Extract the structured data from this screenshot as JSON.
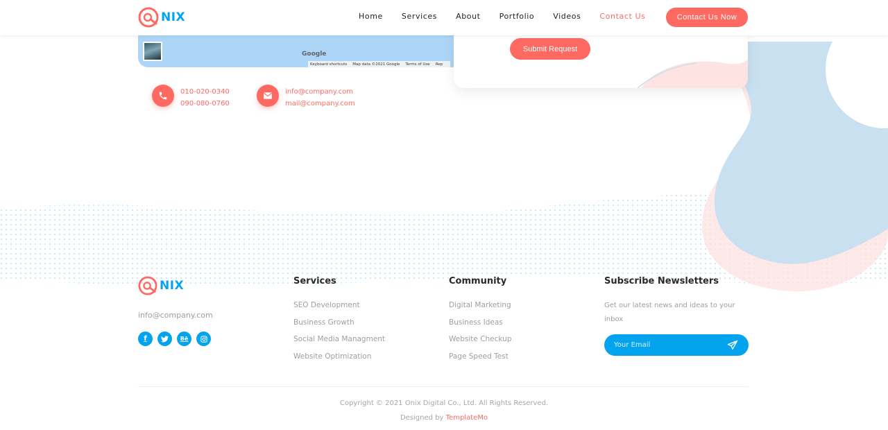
{
  "brand": {
    "name": "NIX"
  },
  "colors": {
    "accent": "#fe6a61",
    "blue": "#03a4ed",
    "heading": "#2a2a2a",
    "muted": "#9e9e9e"
  },
  "nav": {
    "items": [
      {
        "label": "Home",
        "active": false
      },
      {
        "label": "Services",
        "active": false
      },
      {
        "label": "About",
        "active": false
      },
      {
        "label": "Portfolio",
        "active": false
      },
      {
        "label": "Videos",
        "active": false
      },
      {
        "label": "Contact Us",
        "active": true
      }
    ],
    "cta_label": "Contact Us Now"
  },
  "map": {
    "google_label": "Google",
    "attribution": [
      "Keyboard shortcuts",
      "Map data ©2021 Google",
      "Terms of Use",
      "Rep"
    ]
  },
  "contact": {
    "phones": [
      "010-020-0340",
      "090-080-0760"
    ],
    "emails": [
      "info@company.com",
      "mail@company.com"
    ],
    "phone_icon": "phone-icon",
    "email_icon": "envelope-icon"
  },
  "form": {
    "submit_label": "Submit Request"
  },
  "footer": {
    "email": "info@company.com",
    "socials": [
      {
        "icon": "facebook-icon",
        "glyph": "f"
      },
      {
        "icon": "twitter-icon",
        "glyph": ""
      },
      {
        "icon": "behance-icon",
        "glyph": "Bē"
      },
      {
        "icon": "instagram-icon",
        "glyph": ""
      }
    ],
    "services": {
      "title": "Services",
      "links": [
        "SEO Development",
        "Business Growth",
        "Social Media Managment",
        "Website Optimization"
      ]
    },
    "community": {
      "title": "Community",
      "links": [
        "Digital Marketing",
        "Business Ideas",
        "Website Checkup",
        "Page Speed Test"
      ]
    },
    "newsletter": {
      "title": "Subscribe Newsletters",
      "text": "Get our latest news and ideas to your inbox",
      "placeholder": "Your Email",
      "send_icon": "paper-plane-icon"
    }
  },
  "copyright": {
    "text": "Copyright © 2021 Onix Digital Co., Ltd. All Rights Reserved.",
    "designed_by": "Designed by",
    "designer": "TemplateMo"
  }
}
